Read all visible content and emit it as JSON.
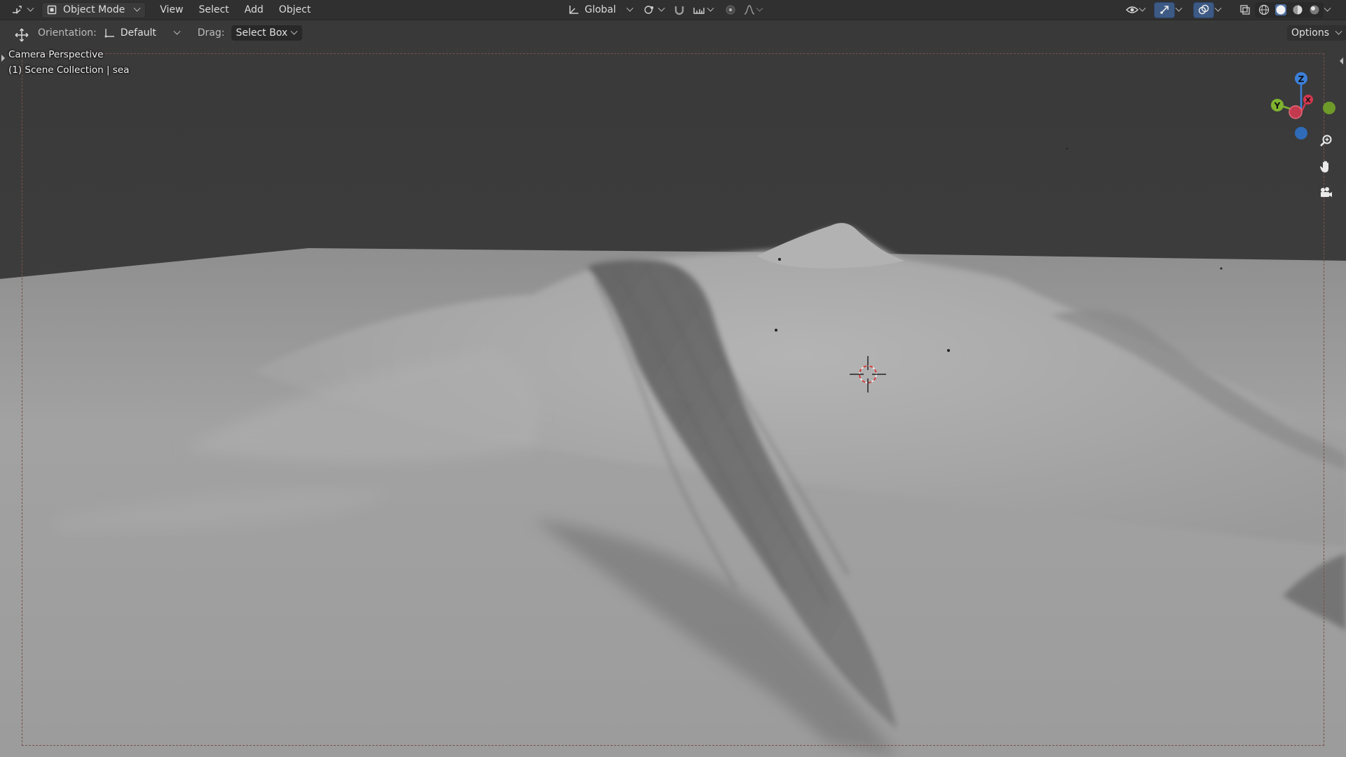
{
  "header": {
    "mode": "Object Mode",
    "menus": [
      "View",
      "Select",
      "Add",
      "Object"
    ],
    "transform_orientation": "Global",
    "icons": {
      "editor_type": "editor-type-icon",
      "mode": "object-mode-icon",
      "orientation": "global-axes-icon",
      "pivot": "pivot-point-icon",
      "snap": "snap-magnet-icon",
      "snap_target": "snap-increment-icon",
      "proportional": "proportional-edit-icon",
      "falloff": "falloff-curve-icon",
      "visibility": "eye-icon",
      "gizmos": "gizmo-icon",
      "overlays": "overlays-icon",
      "xray": "xray-icon",
      "shading_wire": "wireframe-shading-icon",
      "shading_solid": "solid-shading-icon",
      "shading_material": "material-shading-icon",
      "shading_render": "rendered-shading-icon"
    }
  },
  "toolbar": {
    "orientation_label": "Orientation:",
    "orientation_value": "Default",
    "drag_label": "Drag:",
    "drag_value": "Select Box",
    "options_label": "Options"
  },
  "viewport": {
    "view_name": "Camera Perspective",
    "collection_info": "(1) Scene Collection | sea"
  },
  "gizmo": {
    "axis_x": "X",
    "axis_y": "Y",
    "axis_z": "Z",
    "colors": {
      "x": "#d3374e",
      "y": "#7fb32f",
      "z": "#3c7fd8"
    }
  },
  "navigation": {
    "zoom_icon": "zoom-icon",
    "pan_icon": "hand-icon",
    "camera_icon": "camera-icon"
  }
}
